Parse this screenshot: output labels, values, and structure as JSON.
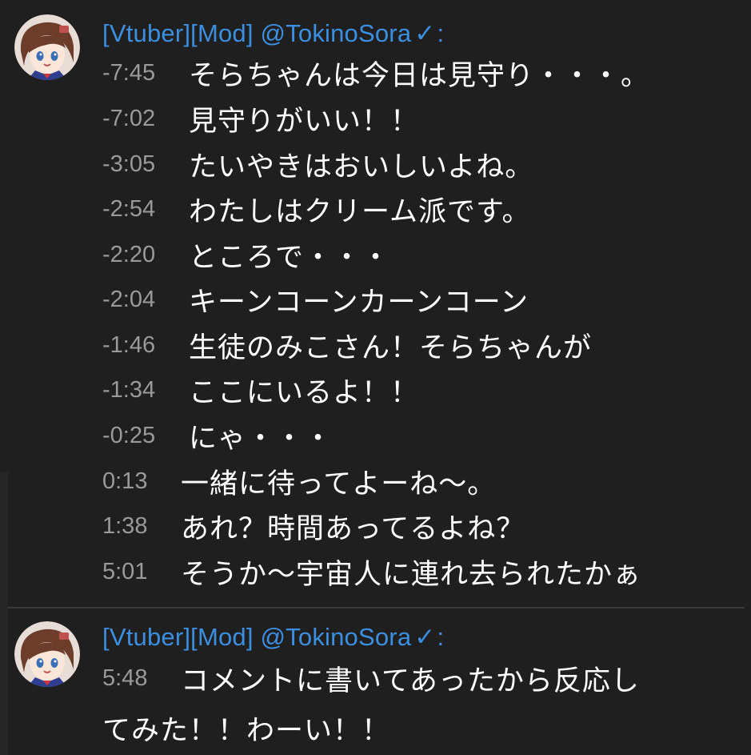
{
  "messages": [
    {
      "author": "[Vtuber][Mod] @TokinoSora",
      "verified_mark": "✓",
      "colon": ":",
      "lines": [
        {
          "time": "-7:45",
          "text": "そらちゃんは今日は見守り・・・。"
        },
        {
          "time": "-7:02",
          "text": "見守りがいい！！"
        },
        {
          "time": "-3:05",
          "text": "たいやきはおいしいよね。"
        },
        {
          "time": "-2:54",
          "text": "わたしはクリーム派です。"
        },
        {
          "time": "-2:20",
          "text": "ところで・・・"
        },
        {
          "time": "-2:04",
          "text": "キーンコーンカーンコーン"
        },
        {
          "time": "-1:46",
          "text": "生徒のみこさん！そらちゃんが"
        },
        {
          "time": "-1:34",
          "text": "ここにいるよ！！"
        },
        {
          "time": "-0:25",
          "text": "にゃ・・・"
        },
        {
          "time": "0:13",
          "text": "一緒に待ってよーね～。"
        },
        {
          "time": "1:38",
          "text": "あれ？時間あってるよね？"
        },
        {
          "time": "5:01",
          "text": "そうか～宇宙人に連れ去られたかぁ"
        }
      ]
    },
    {
      "author": "[Vtuber][Mod] @TokinoSora",
      "verified_mark": "✓",
      "colon": ":",
      "lines": [
        {
          "time": "5:48",
          "text": "コメントに書いてあったから反応し",
          "continuation": "てみた！！わーい！！"
        }
      ]
    }
  ],
  "colors": {
    "background": "#1f1f1f",
    "author": "#3c8fe0",
    "time": "#9a9a9a",
    "text": "#ffffff",
    "divider": "#3a3a3a"
  },
  "icons": {
    "avatar": "avatar-tokinosora",
    "verified": "verified-check-icon"
  }
}
